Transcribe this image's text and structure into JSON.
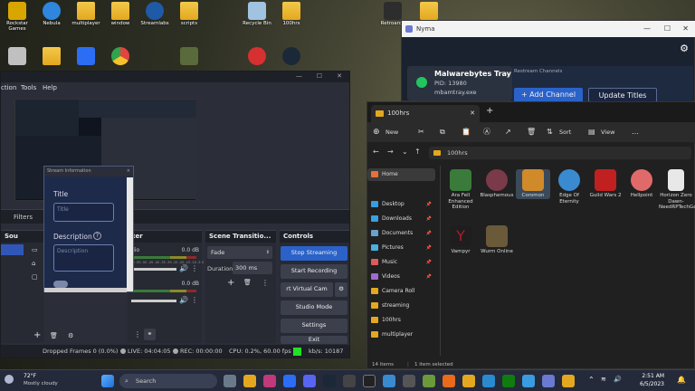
{
  "desktop": {
    "icons": [
      {
        "label": "Rockstar Games",
        "color": "#d9a600"
      },
      {
        "label": "Nebula",
        "color": "#2e86de"
      },
      {
        "label": "multiplayer",
        "color": "folder"
      },
      {
        "label": "window",
        "color": "folder"
      },
      {
        "label": "Streamlabs",
        "color": "#1f5aa6"
      },
      {
        "label": "scripts",
        "color": "folder"
      },
      {
        "label": "Recycle Bin",
        "color": "#9fc3e0"
      },
      {
        "label": "100hrs",
        "color": "folder"
      },
      {
        "label": "Retroarch",
        "color": "#2d2d2d"
      },
      {
        "label": "",
        "color": "folder"
      }
    ],
    "icons_row2": [
      {
        "label": "",
        "color": "#c0c0c0"
      },
      {
        "label": "",
        "color": "folder"
      },
      {
        "label": "",
        "color": "#2b6ef5"
      },
      {
        "label": "",
        "color": "#e2443f"
      },
      {
        "label": "",
        "color": "#5a6a3a"
      },
      {
        "label": "",
        "color": "#d63030"
      },
      {
        "label": "",
        "color": "#1b2838"
      }
    ]
  },
  "obs": {
    "menu": [
      "ction",
      "Tools",
      "Help"
    ],
    "filters_label": "Filters",
    "sources_label": "Sou",
    "mixer_label": "xer",
    "mixer_rows": [
      {
        "label": "dio",
        "db": "0.0 dB"
      },
      {
        "label": "",
        "db": "0.0 dB"
      }
    ],
    "mixer_scale": "-60 -55 -50 -45 -40 -35 -30 -25 -20 -15 -10 -5 0",
    "transitions": {
      "title": "Scene Transitio...",
      "type": "Fade",
      "duration_label": "Duration",
      "duration_value": "300 ms"
    },
    "controls": {
      "title": "Controls",
      "stop_streaming": "Stop Streaming",
      "start_recording": "Start Recording",
      "virtual_cam": "rt Virtual Cam",
      "studio_mode": "Studio Mode",
      "settings": "Settings",
      "exit": "Exit"
    },
    "status": {
      "dropped": "Dropped Frames 0 (0.0%)",
      "live": "LIVE: 04:04:05",
      "rec": "REC: 00:00:00",
      "cpu": "CPU: 0.2%, 60.00 fps",
      "kbs": "kb/s: 10187"
    }
  },
  "stream_info": {
    "title": "Stream Information",
    "title_label": "Title",
    "title_placeholder": "Title",
    "description_label": "Description",
    "description_placeholder": "Description"
  },
  "nyma": {
    "window_title": "Nyma",
    "tray_title": "Malwarebytes Tray Ap",
    "pid": "PID: 13980",
    "exe": "mbamtray.exe",
    "restream_label": "Restream Channels",
    "add_channel": "+ Add Channel",
    "update_titles": "Update Titles"
  },
  "explorer": {
    "tab_title": "100hrs",
    "new_label": "New",
    "sort_label": "Sort",
    "view_label": "View",
    "path": "100hrs",
    "nav": [
      {
        "label": "Home",
        "color": "#e8703a",
        "pin": false
      },
      {
        "label": "Desktop",
        "color": "#3a9be0",
        "pin": true
      },
      {
        "label": "Downloads",
        "color": "#3aa0e0",
        "pin": true
      },
      {
        "label": "Documents",
        "color": "#6aa0d0",
        "pin": true
      },
      {
        "label": "Pictures",
        "color": "#4ab0e0",
        "pin": true
      },
      {
        "label": "Music",
        "color": "#e05a5a",
        "pin": true
      },
      {
        "label": "Videos",
        "color": "#a06ad0",
        "pin": true
      },
      {
        "label": "Camera Roll",
        "color": "#e3a81f",
        "pin": false
      },
      {
        "label": "streaming",
        "color": "#e3a81f",
        "pin": false
      },
      {
        "label": "100hrs",
        "color": "#e3a81f",
        "pin": false
      },
      {
        "label": "multiplayer",
        "color": "#e3a81f",
        "pin": false
      }
    ],
    "items": [
      {
        "label": "Ara Fell Enhanced Edition",
        "color": "#3a7a3a"
      },
      {
        "label": "Blasphemous",
        "color": "#7a3a4a"
      },
      {
        "label": "Coromon",
        "color": "#d08a2a"
      },
      {
        "label": "Edge Of Eternity",
        "color": "#3a8ad0"
      },
      {
        "label": "Guild Wars 2",
        "color": "#c02020"
      },
      {
        "label": "Hellpoint",
        "color": "#e06a6a"
      },
      {
        "label": "Horizon Zero Dawn-NeedRPTechGa...",
        "color": "#e8e8e8"
      },
      {
        "label": "Vampyr",
        "color": "#b01a2a"
      },
      {
        "label": "Wurm Online",
        "color": "#6a5a3a"
      }
    ],
    "status_count": "14 items",
    "status_selected": "1 item selected"
  },
  "taskbar": {
    "temp": "72°F",
    "weather": "Mostly cloudy",
    "search_placeholder": "Search",
    "time": "2:51 AM",
    "date": "6/5/2023"
  }
}
